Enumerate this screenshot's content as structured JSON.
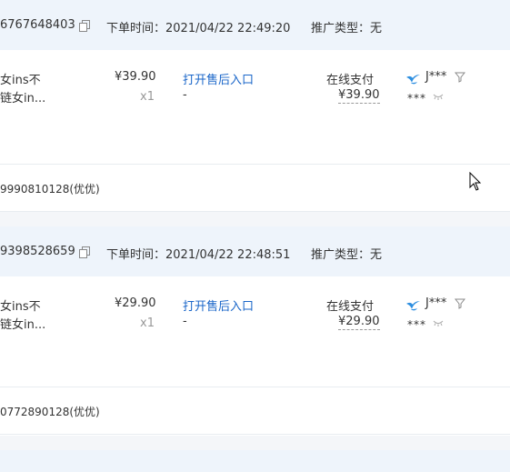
{
  "orders": [
    {
      "order_no": "6767648403",
      "order_time": "下单时间：2021/04/22 22:49:20",
      "promo_type": "推广类型：无",
      "title_line1": "女ins不",
      "title_line2": "链女in...",
      "price": "¥39.90",
      "quantity": "x1",
      "after_sale": "打开售后入口",
      "after_sale_status": "-",
      "pay_method": "在线支付",
      "pay_amount": "¥39.90",
      "buyer": "J***",
      "buyer_mask": "***",
      "remark": "9990810128(优优)"
    },
    {
      "order_no": "9398528659",
      "order_time": "下单时间：2021/04/22 22:48:51",
      "promo_type": "推广类型：无",
      "title_line1": "女ins不",
      "title_line2": "链女in...",
      "price": "¥29.90",
      "quantity": "x1",
      "after_sale": "打开售后入口",
      "after_sale_status": "-",
      "pay_method": "在线支付",
      "pay_amount": "¥29.90",
      "buyer": "J***",
      "buyer_mask": "***",
      "remark": "0772890128(优优)"
    }
  ],
  "partial_next": {
    "order_no": "",
    "order_time": "",
    "promo_type": ""
  },
  "colors": {
    "header_bg": "#eef4fb",
    "link": "#1a66c9",
    "muted": "#999999",
    "bird": "#2e8fe0"
  },
  "icons": {
    "copy": "copy-icon",
    "bird": "bird-icon",
    "filter": "filter-icon",
    "eye": "eye-closed-icon",
    "cursor": "mouse-cursor-icon"
  }
}
